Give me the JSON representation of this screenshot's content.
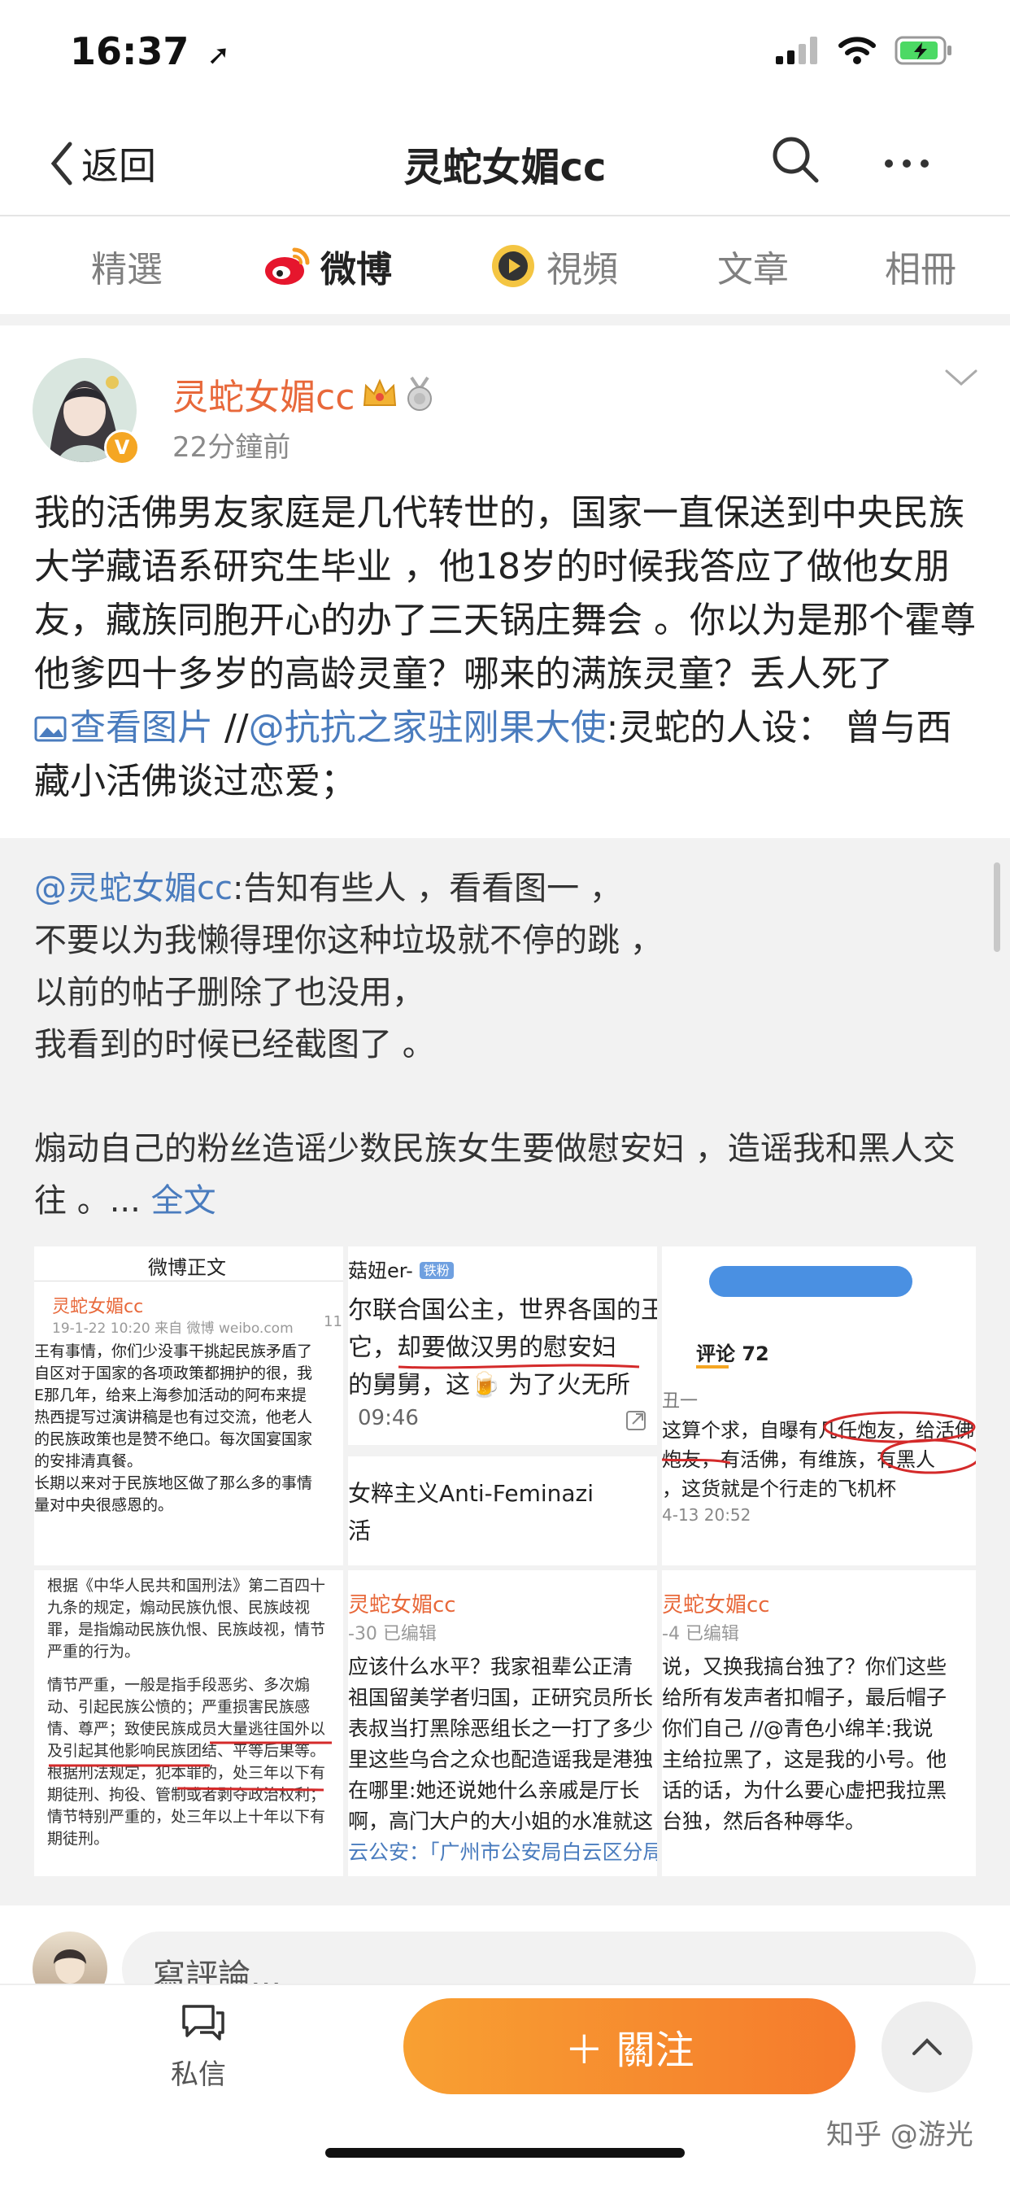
{
  "status": {
    "time": "16:37",
    "battery_color": "#4cd964"
  },
  "nav": {
    "back_label": "返回",
    "title": "灵蛇女媚cc",
    "search_icon": "search-icon",
    "more_icon": "more-icon"
  },
  "tabs": [
    {
      "label": "精選",
      "active": false
    },
    {
      "label": "微博",
      "active": true
    },
    {
      "label": "視頻",
      "active": false
    },
    {
      "label": "文章",
      "active": false
    },
    {
      "label": "相冊",
      "active": false
    }
  ],
  "post": {
    "username": "灵蛇女媚cc",
    "time": "22分鐘前",
    "text_main": "我的活佛男友家庭是几代转世的，国家一直保送到中央民族大学藏语系研究生毕业 ，他18岁的时候我答应了做他女朋友，藏族同胞开心的办了三天锅庄舞会 。你以为是那个霍尊他爹四十多岁的高龄灵童？哪来的满族灵童？丢人死了 ",
    "view_image_link": "查看图片",
    "sep": " //",
    "mention": "@抗抗之家驻刚果大使",
    "text_tail": ":灵蛇的人设： 曾与西藏小活佛谈过恋爱；"
  },
  "repost": {
    "mention": "@灵蛇女媚cc",
    "lines": [
      ":告知有些人 ，看看图一 ，",
      "不要以为我懒得理你这种垃圾就不停的跳 ，",
      "以前的帖子删除了也没用，",
      "我看到的时候已经截图了 。"
    ],
    "para2": "煽动自己的粉丝造谣少数民族女生要做慰安妇 ，造谣我和黑人交往 。... ",
    "full_text_link": "全文"
  },
  "images": {
    "img1": {
      "header": "微博正文",
      "user": "灵蛇女媚cc",
      "meta": "19-1-22 10:20  来自 微博 weibo.com",
      "count": "11",
      "lines": [
        "王有事情，你们少没事干挑起民族矛盾了",
        "自区对于国家的各项政策都拥护的很，我",
        "E那几年，给来上海参加活动的阿布来提",
        "热西提写过演讲稿是也有过交流，他老人",
        "的民族政策也是赞不绝口。每次国宴国家",
        "的安排清真餐。",
        "长期以来对于民族地区做了那么多的事情",
        "量对中央很感恩的。"
      ]
    },
    "img2": {
      "name": "菇妞er-",
      "badge": "铁粉",
      "lines": [
        "尔联合国公主，世界各国的王",
        "它，却要做汉男的慰安妇",
        "的舅舅，这🍺 为了火无所"
      ],
      "time": "09:46",
      "footer": "女粹主义Anti-Feminazi",
      "footer2": "活"
    },
    "img3": {
      "comment_tab": "评论 72",
      "user": "丑一",
      "lines": [
        "这算个求，自曝有几任炮友，给活佛",
        "炮友，有活佛，有维族，有黑人",
        "，这货就是个行走的飞机杯"
      ],
      "time": "4-13 20:52"
    },
    "img4": {
      "lines": [
        "根据《中华人民共和国刑法》第二百四十",
        "九条的规定，煽动民族仇恨、民族歧视",
        "罪，是指煽动民族仇恨、民族歧视，情节",
        "严重的行为。",
        "",
        "情节严重，一般是指手段恶劣、多次煽",
        "动、引起民族公愤的；严重损害民族感",
        "情、尊严；致使民族成员大量逃往国外以",
        "及引起其他影响民族团结、平等后果等。",
        "根据刑法规定，犯本罪的，处三年以下有",
        "期徒刑、拘役、管制或者剥夺政治权利；",
        "情节特别严重的，处三年以上十年以下有",
        "期徒刑。"
      ]
    },
    "img5": {
      "user": "灵蛇女媚cc",
      "meta": "-30  已编辑",
      "lines": [
        "应该什么水平？我家祖辈公正清",
        "祖国留美学者归国，正研究员所长",
        "表叔当打黑除恶组长之一打了多少",
        "里这些乌合之众也配造谣我是港独",
        "在哪里:她还说她什么亲戚是厅长",
        "啊，高门大户的大小姐的水准就这",
        "云公安：「广州市公安局白云区分局"
      ]
    },
    "img6": {
      "user": "灵蛇女媚cc",
      "meta": "-4  已编辑",
      "lines": [
        "说，又换我搞台独了？你们这些",
        "给所有发声者扣帽子，最后帽子",
        "你们自己 //@青色小绵羊:我说",
        "主给拉黑了，这是我的小号。他",
        "话的话，为什么要心虚把我拉黑",
        "台独，然后各种辱华。"
      ]
    }
  },
  "comment": {
    "placeholder": "寫評論..."
  },
  "bottom": {
    "message_label": "私信",
    "follow_label": "＋ 關注",
    "watermark": "知乎 @游光"
  }
}
